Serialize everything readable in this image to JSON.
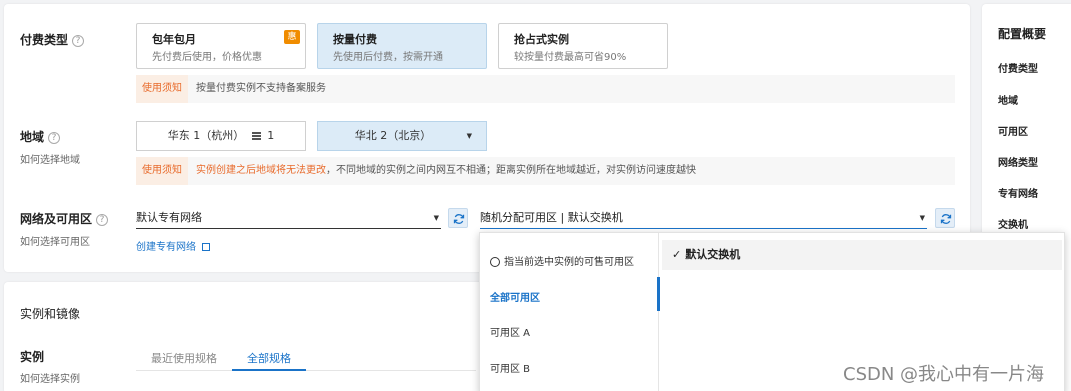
{
  "billing": {
    "label": "付费类型",
    "help": "?",
    "options": [
      {
        "title": "包年包月",
        "desc": "先付费后使用，价格优惠",
        "badge": "惠"
      },
      {
        "title": "按量付费",
        "desc": "先使用后付费，按需开通"
      },
      {
        "title": "抢占式实例",
        "desc": "较按量付费最高可省90%"
      }
    ],
    "notice_tag": "使用须知",
    "notice_msg": "按量付费实例不支持备案服务"
  },
  "region": {
    "label": "地域",
    "help": "?",
    "sub_link": "如何选择地域",
    "options": [
      {
        "label": "华东 1（杭州）",
        "count": "1"
      },
      {
        "label": "华北 2（北京）"
      }
    ],
    "notice_tag": "使用须知",
    "notice_warn": "实例创建之后地域将无法更改",
    "notice_msg": "，不同地域的实例之间内网互不相通；距离实例所在地域越近，对实例访问速度越快"
  },
  "network": {
    "label": "网络及可用区",
    "help": "?",
    "sub_link": "如何选择可用区",
    "vpc_value": "默认专有网络",
    "zone_value": "随机分配可用区 | 默认交换机",
    "create_link": "创建专有网络",
    "dropdown": {
      "left_items": [
        "指当前选中实例的可售可用区",
        "全部可用区",
        "可用区 A",
        "可用区 B"
      ],
      "active_index": 1,
      "right_selected": "默认交换机",
      "check": "✓"
    }
  },
  "instance_section": {
    "title": "实例和镜像",
    "label": "实例",
    "sub_link": "如何选择实例",
    "tabs": [
      "最近使用规格",
      "全部规格"
    ],
    "active_tab": 1
  },
  "summary": {
    "title": "配置概要",
    "items": [
      "付费类型",
      "地域",
      "可用区",
      "网络类型",
      "专有网络",
      "交换机"
    ]
  },
  "watermark": "CSDN @我心中有一片海",
  "colors": {
    "accent": "#1a73c8",
    "warn": "#e86b2c",
    "badge": "#f08c00",
    "selected_bg": "#dcebf7"
  }
}
